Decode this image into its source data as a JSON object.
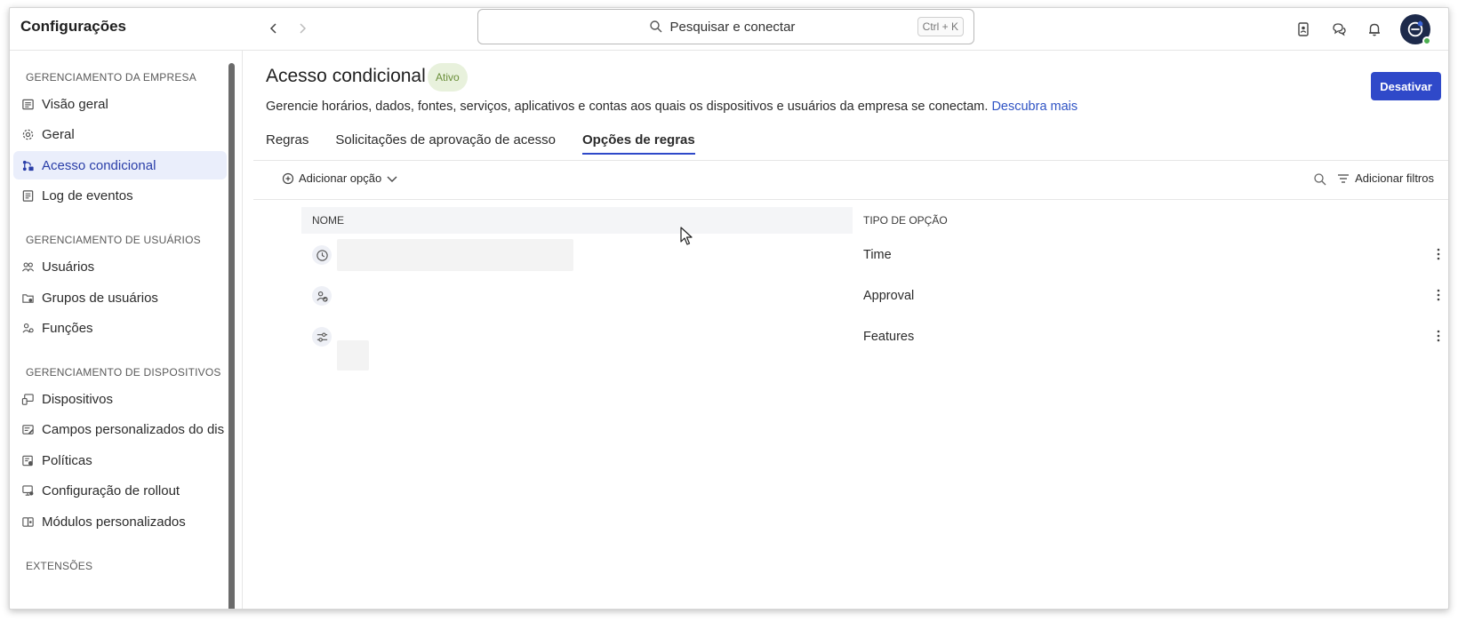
{
  "app": {
    "title": "Configurações"
  },
  "search": {
    "placeholder": "Pesquisar e conectar",
    "shortcut": "Ctrl + K"
  },
  "sidebar": {
    "sections": [
      {
        "title": "GERENCIAMENTO DA EMPRESA"
      },
      {
        "title": "GERENCIAMENTO DE USUÁRIOS"
      },
      {
        "title": "GERENCIAMENTO DE DISPOSITIVOS"
      },
      {
        "title": "EXTENSÕES"
      }
    ],
    "items": [
      {
        "label": "Visão geral",
        "icon": "overview-icon"
      },
      {
        "label": "Geral",
        "icon": "gear-icon"
      },
      {
        "label": "Acesso condicional",
        "icon": "conditional-access-icon",
        "active": true
      },
      {
        "label": "Log de eventos",
        "icon": "event-log-icon"
      },
      {
        "label": "Usuários",
        "icon": "users-icon"
      },
      {
        "label": "Grupos de usuários",
        "icon": "user-groups-icon"
      },
      {
        "label": "Funções",
        "icon": "roles-icon"
      },
      {
        "label": "Dispositivos",
        "icon": "devices-icon"
      },
      {
        "label": "Campos personalizados do dis",
        "icon": "custom-fields-icon"
      },
      {
        "label": "Políticas",
        "icon": "policies-icon"
      },
      {
        "label": "Configuração de rollout",
        "icon": "rollout-icon"
      },
      {
        "label": "Módulos personalizados",
        "icon": "custom-modules-icon"
      }
    ]
  },
  "page": {
    "title": "Acesso condicional",
    "status": "Ativo",
    "description": "Gerencie horários, dados, fontes, serviços, aplicativos e contas aos quais os dispositivos e usuários da empresa se conectam.",
    "learn_more": "Descubra mais",
    "deactivate_label": "Desativar"
  },
  "tabs": [
    {
      "label": "Regras"
    },
    {
      "label": "Solicitações de aprovação de acesso"
    },
    {
      "label": "Opções de regras",
      "active": true
    }
  ],
  "toolbar": {
    "add_option_label": "Adicionar opção",
    "add_filters_label": "Adicionar filtros"
  },
  "table": {
    "columns": [
      "NOME",
      "TIPO DE OPÇÃO"
    ],
    "rows": [
      {
        "icon": "clock-icon",
        "type": "Time"
      },
      {
        "icon": "approval-icon",
        "type": "Approval"
      },
      {
        "icon": "features-icon",
        "type": "Features"
      }
    ]
  },
  "colors": {
    "accent": "#2f49c9",
    "active_bg": "#eaeefb",
    "badge_bg": "#e8f1dc",
    "badge_text": "#6b8f3a",
    "link": "#2f53c4"
  }
}
